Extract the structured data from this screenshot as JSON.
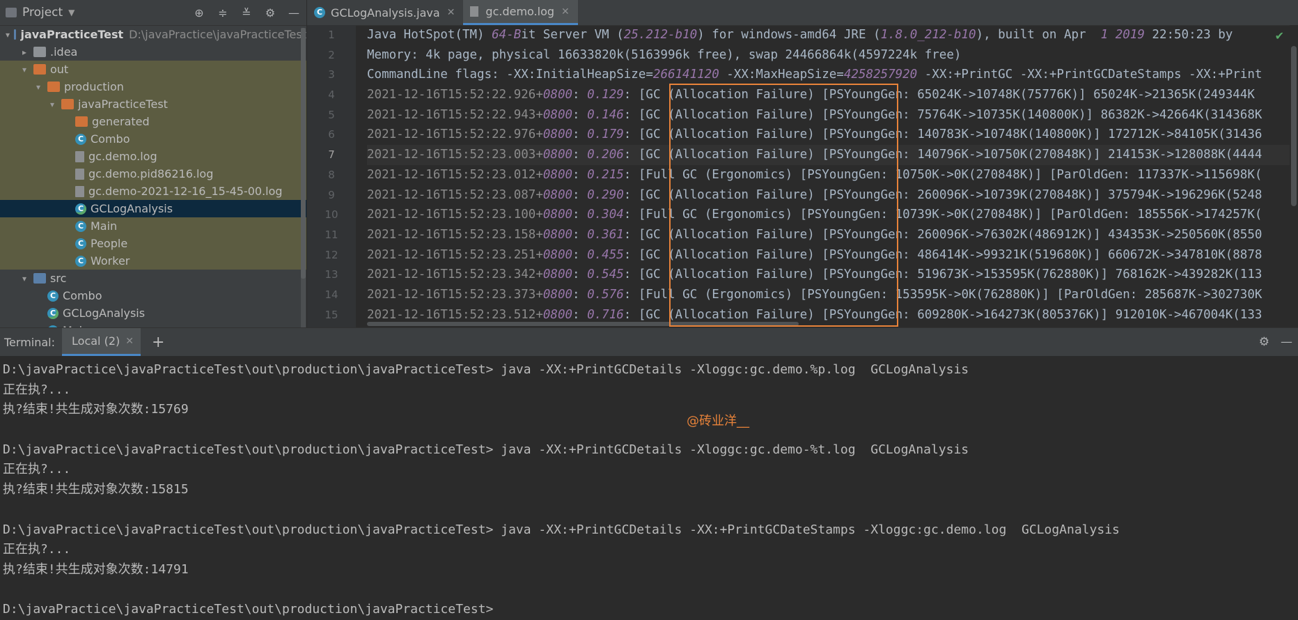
{
  "project": {
    "title": "Project",
    "tree": [
      {
        "label": "javaPracticeTest",
        "path": "D:\\javaPractice\\javaPracticeTest",
        "icon": "folder-blue",
        "level": 0,
        "arrow": "▾",
        "bold": true
      },
      {
        "label": ".idea",
        "icon": "folder-grey",
        "level": 1,
        "arrow": "▸"
      },
      {
        "label": "out",
        "icon": "folder-orange",
        "level": 1,
        "arrow": "▾",
        "dim": true
      },
      {
        "label": "production",
        "icon": "folder-orange",
        "level": 2,
        "arrow": "▾",
        "dim": true
      },
      {
        "label": "javaPracticeTest",
        "icon": "folder-orange",
        "level": 3,
        "arrow": "▾",
        "dim": true
      },
      {
        "label": "generated",
        "icon": "folder-orange",
        "level": 4,
        "arrow": "",
        "dim": true
      },
      {
        "label": "Combo",
        "icon": "class-c",
        "level": 4,
        "arrow": "",
        "dim": true
      },
      {
        "label": "gc.demo.log",
        "icon": "file-log",
        "level": 4,
        "arrow": "",
        "dim": true
      },
      {
        "label": "gc.demo.pid86216.log",
        "icon": "file-log",
        "level": 4,
        "arrow": "",
        "dim": true
      },
      {
        "label": "gc.demo-2021-12-16_15-45-00.log",
        "icon": "file-log",
        "level": 4,
        "arrow": "",
        "dim": true
      },
      {
        "label": "GCLogAnalysis",
        "icon": "class-c-main",
        "level": 4,
        "arrow": "",
        "selected": true
      },
      {
        "label": "Main",
        "icon": "class-c",
        "level": 4,
        "arrow": "",
        "dim": true
      },
      {
        "label": "People",
        "icon": "class-c",
        "level": 4,
        "arrow": "",
        "dim": true
      },
      {
        "label": "Worker",
        "icon": "class-c",
        "level": 4,
        "arrow": "",
        "dim": true
      },
      {
        "label": "src",
        "icon": "folder-blue",
        "level": 1,
        "arrow": "▾"
      },
      {
        "label": "Combo",
        "icon": "class-c",
        "level": 2,
        "arrow": ""
      },
      {
        "label": "GCLogAnalysis",
        "icon": "class-c-main",
        "level": 2,
        "arrow": ""
      },
      {
        "label": "Main",
        "icon": "class-c",
        "level": 2,
        "arrow": ""
      }
    ]
  },
  "editor": {
    "tabs": [
      {
        "label": "GCLogAnalysis.java",
        "active": false
      },
      {
        "label": "gc.demo.log",
        "active": true
      }
    ],
    "current_line": 7,
    "lines": [
      [
        [
          "Java HotSpot(TM) ",
          ""
        ],
        [
          "64-B",
          "it"
        ],
        [
          "it Server VM (",
          ""
        ],
        [
          "25.212-b10",
          "it"
        ],
        [
          ") for windows-amd64 JRE (",
          ""
        ],
        [
          "1.8.0_212-b10",
          "it"
        ],
        [
          "), built on Apr  ",
          ""
        ],
        [
          "1 2019",
          "it"
        ],
        [
          " 22:50:23 by",
          ""
        ]
      ],
      [
        [
          "Memory: 4k page, physical 16633820k(5163996k free), swap 24466864k(4597224k free)",
          ""
        ]
      ],
      [
        [
          "CommandLine flags: -XX:InitialHeapSize=",
          ""
        ],
        [
          "266141120",
          "it"
        ],
        [
          " -XX:MaxHeapSize=",
          ""
        ],
        [
          "4258257920",
          "it"
        ],
        [
          " -XX:+PrintGC -XX:+PrintGCDateStamps -XX:+Print",
          ""
        ]
      ],
      [
        [
          "2021-12-16T15:52:22.926+",
          "dim"
        ],
        [
          "0800",
          "it"
        ],
        [
          ": ",
          ""
        ],
        [
          "0.129",
          "it"
        ],
        [
          ": [GC (Allocation Failure) [PSYoungGen: 65024K->10748K(75776K)] 65024K->21365K(249344K",
          ""
        ]
      ],
      [
        [
          "2021-12-16T15:52:22.943+",
          "dim"
        ],
        [
          "0800",
          "it"
        ],
        [
          ": ",
          ""
        ],
        [
          "0.146",
          "it"
        ],
        [
          ": [GC (Allocation Failure) [PSYoungGen: 75764K->10735K(140800K)] 86382K->42664K(314368K",
          ""
        ]
      ],
      [
        [
          "2021-12-16T15:52:22.976+",
          "dim"
        ],
        [
          "0800",
          "it"
        ],
        [
          ": ",
          ""
        ],
        [
          "0.179",
          "it"
        ],
        [
          ": [GC (Allocation Failure) [PSYoungGen: 140783K->10748K(140800K)] 172712K->84105K(31436",
          ""
        ]
      ],
      [
        [
          "2021-12-16T15:52:23.003+",
          "dim"
        ],
        [
          "0800",
          "it"
        ],
        [
          ": ",
          ""
        ],
        [
          "0.206",
          "it"
        ],
        [
          ": [GC (Allocation Failure) [PSYoungGen: 140796K->10750K(270848K)] 214153K->128088K(4444",
          ""
        ]
      ],
      [
        [
          "2021-12-16T15:52:23.012+",
          "dim"
        ],
        [
          "0800",
          "it"
        ],
        [
          ": ",
          ""
        ],
        [
          "0.215",
          "it"
        ],
        [
          ": [Full GC (Ergonomics) [PSYoungGen: 10750K->0K(270848K)] [ParOldGen: 117337K->115698K(",
          ""
        ]
      ],
      [
        [
          "2021-12-16T15:52:23.087+",
          "dim"
        ],
        [
          "0800",
          "it"
        ],
        [
          ": ",
          ""
        ],
        [
          "0.290",
          "it"
        ],
        [
          ": [GC (Allocation Failure) [PSYoungGen: 260096K->10739K(270848K)] 375794K->196296K(5248",
          ""
        ]
      ],
      [
        [
          "2021-12-16T15:52:23.100+",
          "dim"
        ],
        [
          "0800",
          "it"
        ],
        [
          ": ",
          ""
        ],
        [
          "0.304",
          "it"
        ],
        [
          ": [Full GC (Ergonomics) [PSYoungGen: 10739K->0K(270848K)] [ParOldGen: 185556K->174257K(",
          ""
        ]
      ],
      [
        [
          "2021-12-16T15:52:23.158+",
          "dim"
        ],
        [
          "0800",
          "it"
        ],
        [
          ": ",
          ""
        ],
        [
          "0.361",
          "it"
        ],
        [
          ": [GC (Allocation Failure) [PSYoungGen: 260096K->76302K(486912K)] 434353K->250560K(8550",
          ""
        ]
      ],
      [
        [
          "2021-12-16T15:52:23.251+",
          "dim"
        ],
        [
          "0800",
          "it"
        ],
        [
          ": ",
          ""
        ],
        [
          "0.455",
          "it"
        ],
        [
          ": [GC (Allocation Failure) [PSYoungGen: 486414K->99321K(519680K)] 660672K->347810K(8878",
          ""
        ]
      ],
      [
        [
          "2021-12-16T15:52:23.342+",
          "dim"
        ],
        [
          "0800",
          "it"
        ],
        [
          ": ",
          ""
        ],
        [
          "0.545",
          "it"
        ],
        [
          ": [GC (Allocation Failure) [PSYoungGen: 519673K->153595K(762880K)] 768162K->439282K(113",
          ""
        ]
      ],
      [
        [
          "2021-12-16T15:52:23.373+",
          "dim"
        ],
        [
          "0800",
          "it"
        ],
        [
          ": ",
          ""
        ],
        [
          "0.576",
          "it"
        ],
        [
          ": [Full GC (Ergonomics) [PSYoungGen: 153595K->0K(762880K)] [ParOldGen: 285687K->302730K",
          ""
        ]
      ],
      [
        [
          "2021-12-16T15:52:23.512+",
          "dim"
        ],
        [
          "0800",
          "it"
        ],
        [
          ": ",
          ""
        ],
        [
          "0.716",
          "it"
        ],
        [
          ": [GC (Allocation Failure) [PSYoungGen: 609280K->164273K(805376K)] 912010K->467004K(133",
          ""
        ]
      ]
    ],
    "line_numbers": [
      "1",
      "2",
      "3",
      "4",
      "5",
      "6",
      "7",
      "8",
      "9",
      "10",
      "11",
      "12",
      "13",
      "14",
      "15"
    ]
  },
  "terminal": {
    "label": "Terminal:",
    "tab_label": "Local (2)",
    "watermark": "@砖业洋__",
    "lines": [
      "D:\\javaPractice\\javaPracticeTest\\out\\production\\javaPracticeTest> java -XX:+PrintGCDetails -Xloggc:gc.demo.%p.log  GCLogAnalysis",
      "正在执?...",
      "执?结束!共生成对象次数:15769",
      "",
      "D:\\javaPractice\\javaPracticeTest\\out\\production\\javaPracticeTest> java -XX:+PrintGCDetails -Xloggc:gc.demo-%t.log  GCLogAnalysis",
      "正在执?...",
      "执?结束!共生成对象次数:15815",
      "",
      "D:\\javaPractice\\javaPracticeTest\\out\\production\\javaPracticeTest> java -XX:+PrintGCDetails -XX:+PrintGCDateStamps -Xloggc:gc.demo.log  GCLogAnalysis",
      "正在执?...",
      "执?结束!共生成对象次数:14791",
      "",
      "D:\\javaPractice\\javaPracticeTest\\out\\production\\javaPracticeTest>"
    ]
  },
  "colors": {
    "accent": "#4a88c7",
    "highlight_box": "#e8833a",
    "italic_number": "#9876aa"
  }
}
